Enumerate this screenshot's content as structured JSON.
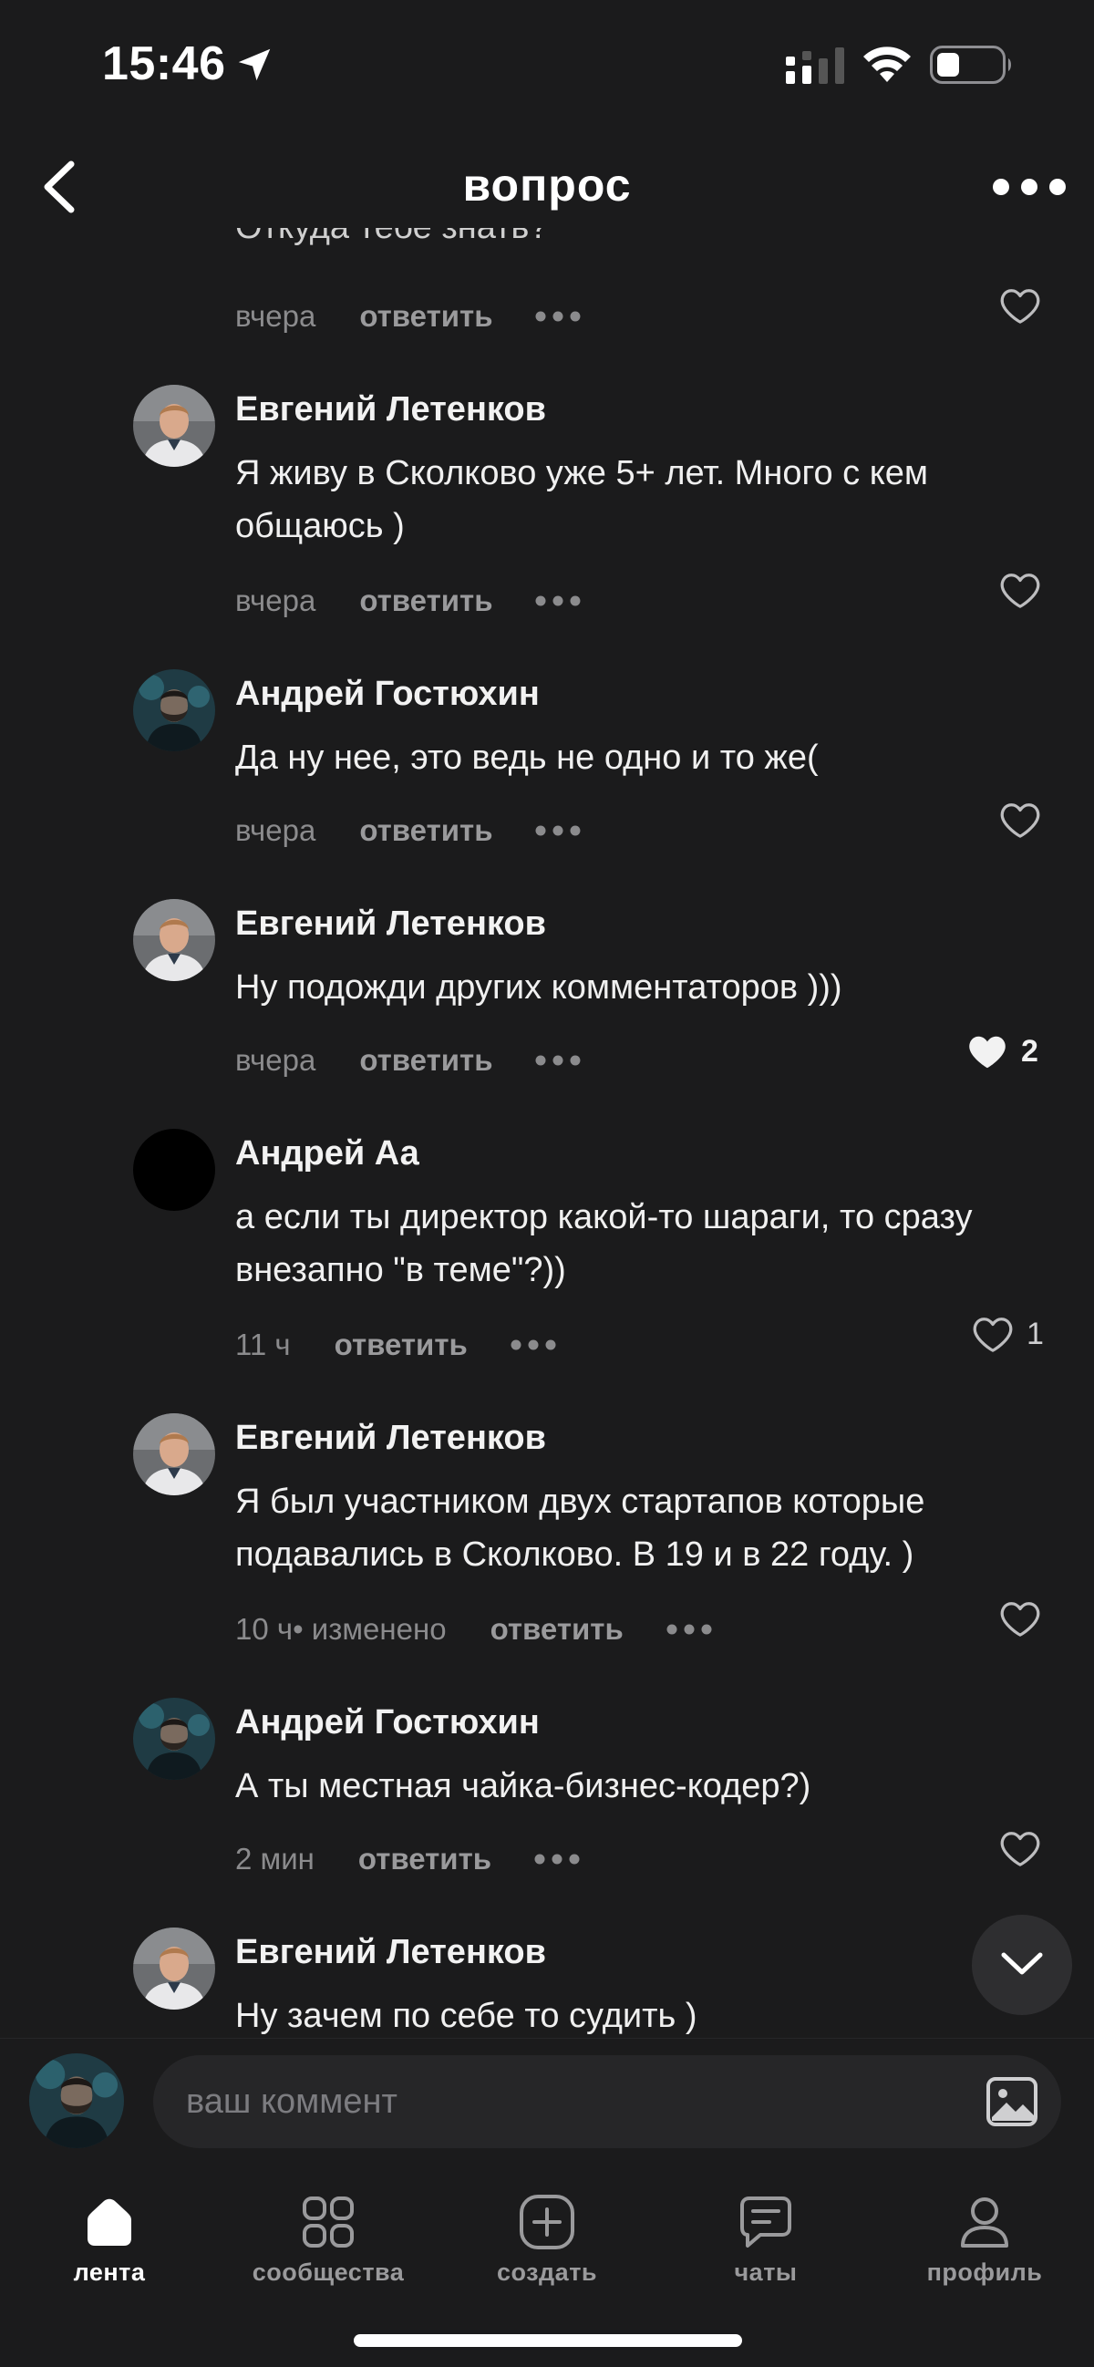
{
  "status_bar": {
    "time": "15:46"
  },
  "header": {
    "title": "вопрос"
  },
  "partial_comment": {
    "text": "Откуда тебе знать?",
    "time": "вчера",
    "reply_label": "ответить"
  },
  "comments": [
    {
      "author": "Евгений Летенков",
      "text": "Я живу в Сколково уже 5+ лет. Много с кем общаюсь )",
      "time": "вчера",
      "reply_label": "ответить",
      "likes": ""
    },
    {
      "author": "Андрей Гостюхин",
      "text": "Да ну нее, это ведь не одно и то же(",
      "time": "вчера",
      "reply_label": "ответить",
      "likes": ""
    },
    {
      "author": "Евгений Летенков",
      "text": "Ну подожди других комментаторов )))",
      "time": "вчера",
      "reply_label": "ответить",
      "likes": "2",
      "liked": true
    },
    {
      "author": "Андрей Аа",
      "text": "а если ты директор какой-то шараги, то сразу внезапно \"в теме\"?))",
      "time": "11 ч",
      "reply_label": "ответить",
      "likes": "1"
    },
    {
      "author": "Евгений Летенков",
      "text": "Я был участником двух стартапов которые подавались в Сколково. В 19 и в 22 году. )",
      "time": "10 ч",
      "edited": " • изменено",
      "reply_label": "ответить",
      "likes": ""
    },
    {
      "author": "Андрей Гостюхин",
      "text": "А ты местная чайка-бизнес-кодер?)",
      "time": "2 мин",
      "reply_label": "ответить",
      "likes": ""
    },
    {
      "author": "Евгений Летенков",
      "text": "Ну зачем по себе то судить )"
    }
  ],
  "composer": {
    "placeholder": "ваш коммент"
  },
  "tabbar": {
    "items": [
      {
        "label": "лента",
        "icon": "home-icon",
        "active": true
      },
      {
        "label": "сообщества",
        "icon": "grid-icon"
      },
      {
        "label": "создать",
        "icon": "plus-square-icon"
      },
      {
        "label": "чаты",
        "icon": "chat-bubble-icon"
      },
      {
        "label": "профиль",
        "icon": "person-icon"
      }
    ]
  },
  "colors": {
    "background": "#1b1b1c",
    "muted_text": "#8b8b8d",
    "input_bg": "#262628"
  }
}
